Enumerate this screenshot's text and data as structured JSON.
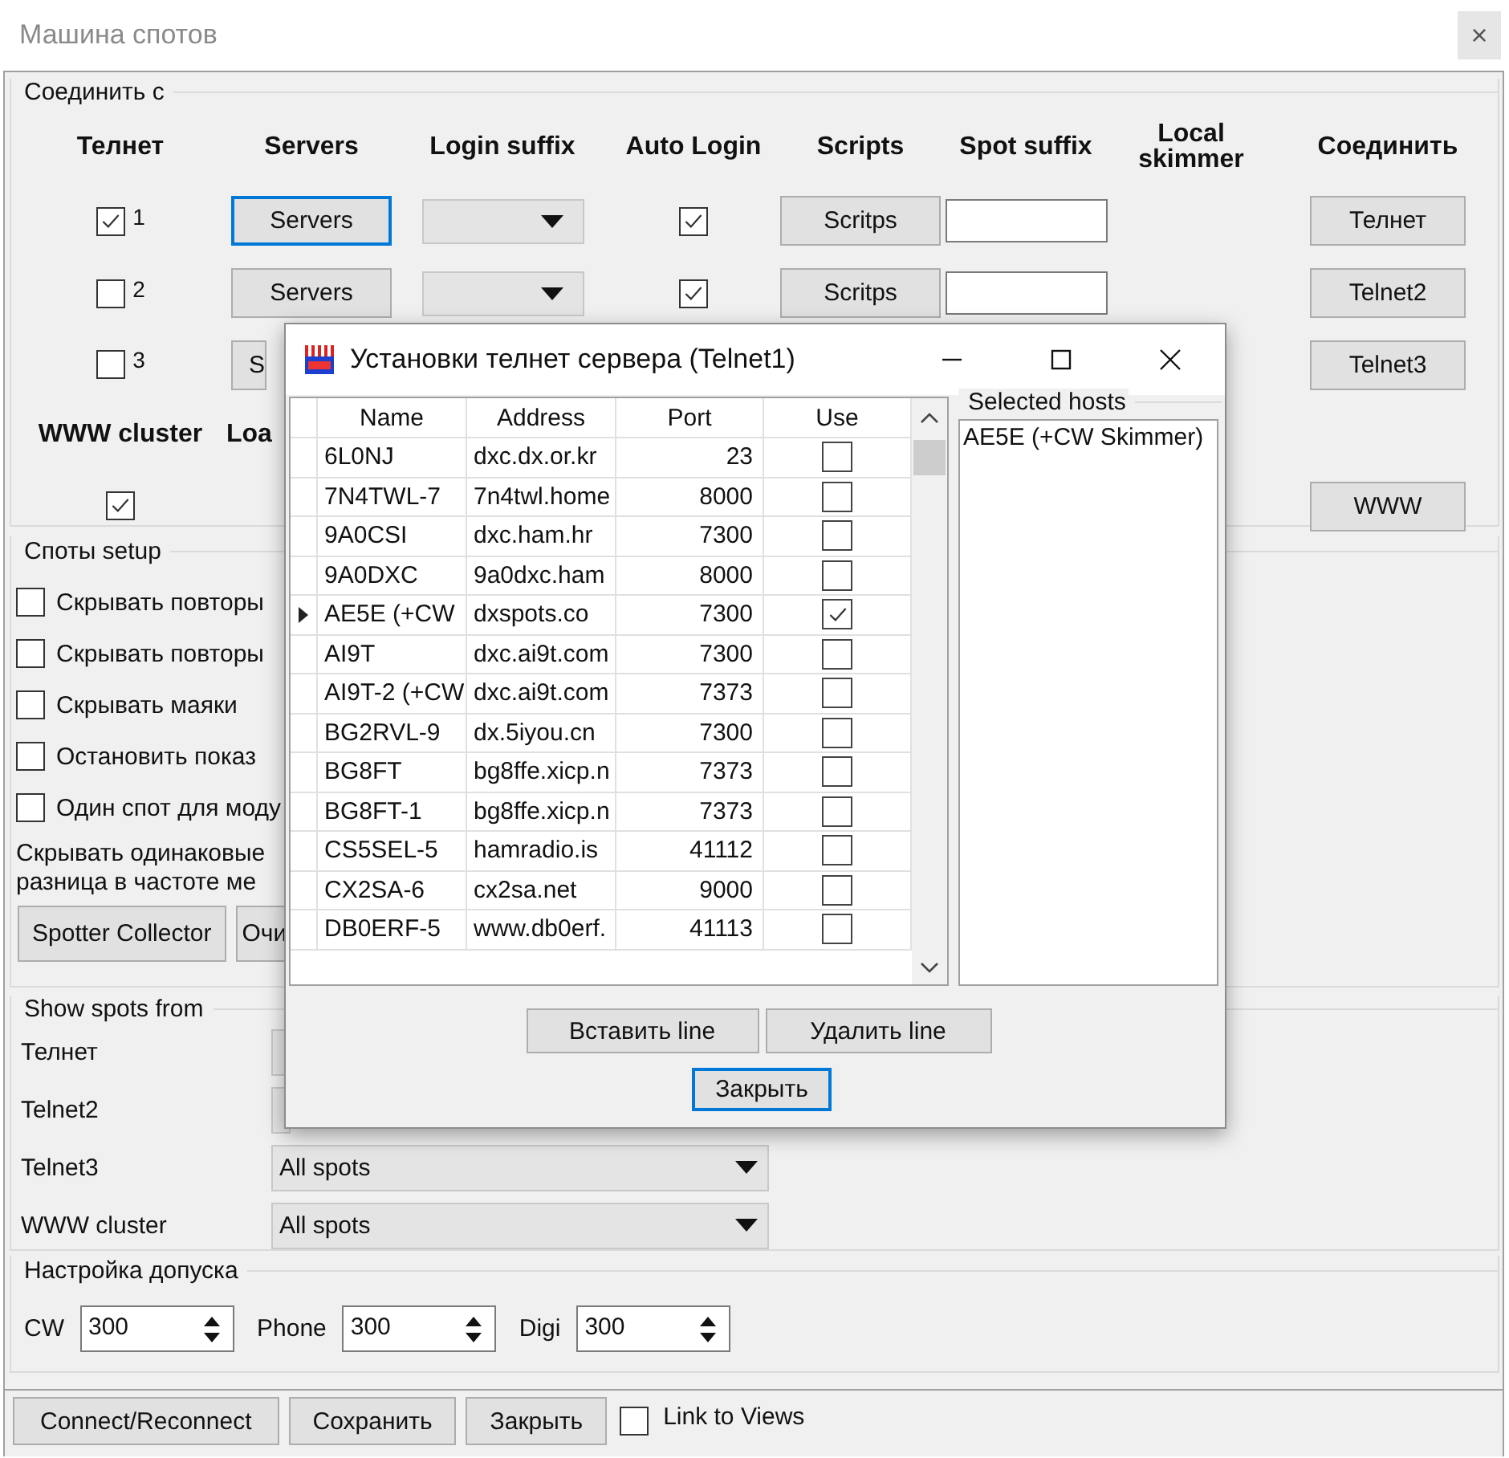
{
  "window": {
    "title": "Машина спотов",
    "close": "×"
  },
  "connect_group": {
    "title": "Соединить с",
    "columns": [
      "Телнет",
      "Servers",
      "Login suffix",
      "Auto Login",
      "Scripts",
      "Spot suffix",
      "Local skimmer",
      "Соединить"
    ],
    "rows": [
      {
        "kind": "full",
        "checked": true,
        "number": "1",
        "servers": "Servers",
        "servers_focused": true,
        "auto_login": true,
        "scripts": "Scritps",
        "connect": "Телнет"
      },
      {
        "kind": "full",
        "checked": false,
        "number": "2",
        "servers": "Servers",
        "servers_focused": false,
        "auto_login": true,
        "scripts": "Scritps",
        "connect": "Telnet2"
      },
      {
        "kind": "partial",
        "checked": false,
        "number": "3",
        "servers": "S",
        "servers_focused": false,
        "connect": "Telnet3"
      }
    ],
    "www": {
      "label": "WWW cluster",
      "label_2": "Loa",
      "checked": true,
      "button": "WWW"
    }
  },
  "spots_setup": {
    "title": "Споты setup",
    "options": [
      {
        "label": "Скрывать повторы",
        "checked": false
      },
      {
        "label": "Скрывать повторы",
        "checked": false
      },
      {
        "label": "Скрывать маяки",
        "checked": false
      },
      {
        "label": "Остановить показ",
        "checked": false
      },
      {
        "label": "Один спот для моду",
        "checked": false
      }
    ],
    "note": [
      "Скрывать одинаковые",
      "разница в частоте ме"
    ],
    "buttons": [
      "Spotter Collector",
      "Очи"
    ]
  },
  "show_spots": {
    "title": "Show spots from",
    "rows": [
      {
        "label": "Телнет",
        "kind": "clipped"
      },
      {
        "label": "Telnet2",
        "kind": "clipped"
      },
      {
        "label": "Telnet3",
        "value": "All spots",
        "kind": "full"
      },
      {
        "label": "WWW cluster",
        "value": "All spots",
        "kind": "full"
      }
    ]
  },
  "tolerance": {
    "title": "Настройка допуска",
    "fields": [
      {
        "label": "CW",
        "value": "300"
      },
      {
        "label": "Phone",
        "value": "300"
      },
      {
        "label": "Digi",
        "value": "300"
      }
    ]
  },
  "footer": {
    "buttons": [
      "Connect/Reconnect",
      "Сохранить",
      "Закрыть"
    ],
    "link_to_views": {
      "label": "Link to Views",
      "checked": false
    }
  },
  "dialog": {
    "title": "Установки телнет сервера (Telnet1)",
    "columns": [
      "Name",
      "Address",
      "Port",
      "Use"
    ],
    "rows": [
      {
        "name": "6L0NJ",
        "address": "dxc.dx.or.kr",
        "port": "23",
        "use": false,
        "current": false
      },
      {
        "name": "7N4TWL-7",
        "address": "7n4twl.home",
        "port": "8000",
        "use": false,
        "current": false
      },
      {
        "name": "9A0CSI",
        "address": "dxc.ham.hr",
        "port": "7300",
        "use": false,
        "current": false
      },
      {
        "name": "9A0DXC",
        "address": "9a0dxc.ham",
        "port": "8000",
        "use": false,
        "current": false
      },
      {
        "name": "AE5E (+CW",
        "address": "dxspots.co",
        "port": "7300",
        "use": true,
        "current": true
      },
      {
        "name": "AI9T",
        "address": "dxc.ai9t.com",
        "port": "7300",
        "use": false,
        "current": false
      },
      {
        "name": "AI9T-2 (+CW",
        "address": "dxc.ai9t.com",
        "port": "7373",
        "use": false,
        "current": false
      },
      {
        "name": "BG2RVL-9",
        "address": "dx.5iyou.cn",
        "port": "7300",
        "use": false,
        "current": false
      },
      {
        "name": "BG8FT",
        "address": "bg8ffe.xicp.n",
        "port": "7373",
        "use": false,
        "current": false
      },
      {
        "name": "BG8FT-1",
        "address": "bg8ffe.xicp.n",
        "port": "7373",
        "use": false,
        "current": false
      },
      {
        "name": "CS5SEL-5",
        "address": "hamradio.is",
        "port": "41112",
        "use": false,
        "current": false
      },
      {
        "name": "CX2SA-6",
        "address": "cx2sa.net",
        "port": "9000",
        "use": false,
        "current": false
      },
      {
        "name": "DB0ERF-5",
        "address": "www.db0erf.",
        "port": "41113",
        "use": false,
        "current": false
      }
    ],
    "selected_hosts": {
      "title": "Selected hosts",
      "items": [
        "AE5E (+CW Skimmer)"
      ]
    },
    "buttons": [
      "Вставить line",
      "Удалить line"
    ],
    "close_button": "Закрыть"
  }
}
